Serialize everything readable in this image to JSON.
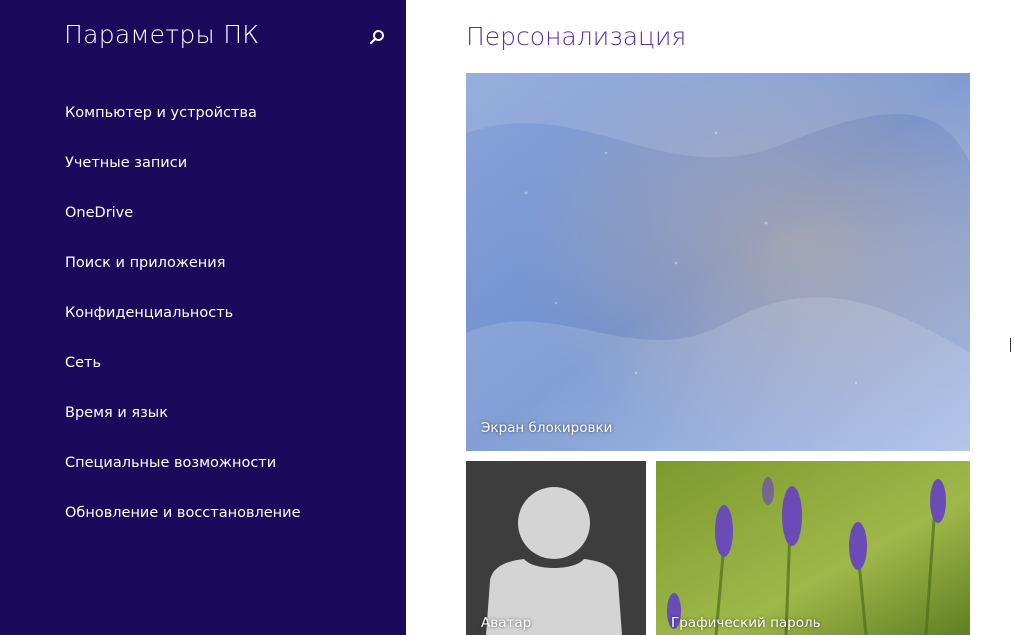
{
  "sidebar": {
    "title": "Параметры ПК",
    "search_icon": "search-icon",
    "items": [
      {
        "label": "Компьютер и устройства"
      },
      {
        "label": "Учетные записи"
      },
      {
        "label": "OneDrive"
      },
      {
        "label": "Поиск и приложения"
      },
      {
        "label": "Конфиденциальность"
      },
      {
        "label": "Сеть"
      },
      {
        "label": "Время и язык"
      },
      {
        "label": "Специальные возможности"
      },
      {
        "label": "Обновление и восстановление"
      }
    ]
  },
  "main": {
    "title": "Персонализация",
    "tiles": {
      "lock_screen": {
        "label": "Экран блокировки"
      },
      "avatar": {
        "label": "Аватар"
      },
      "picture_password": {
        "label": "Графический пароль"
      }
    }
  },
  "colors": {
    "sidebar_bg": "#1b0a5b",
    "title_accent": "#5b2d9f",
    "avatar_tile_bg": "#3d3d3d"
  }
}
